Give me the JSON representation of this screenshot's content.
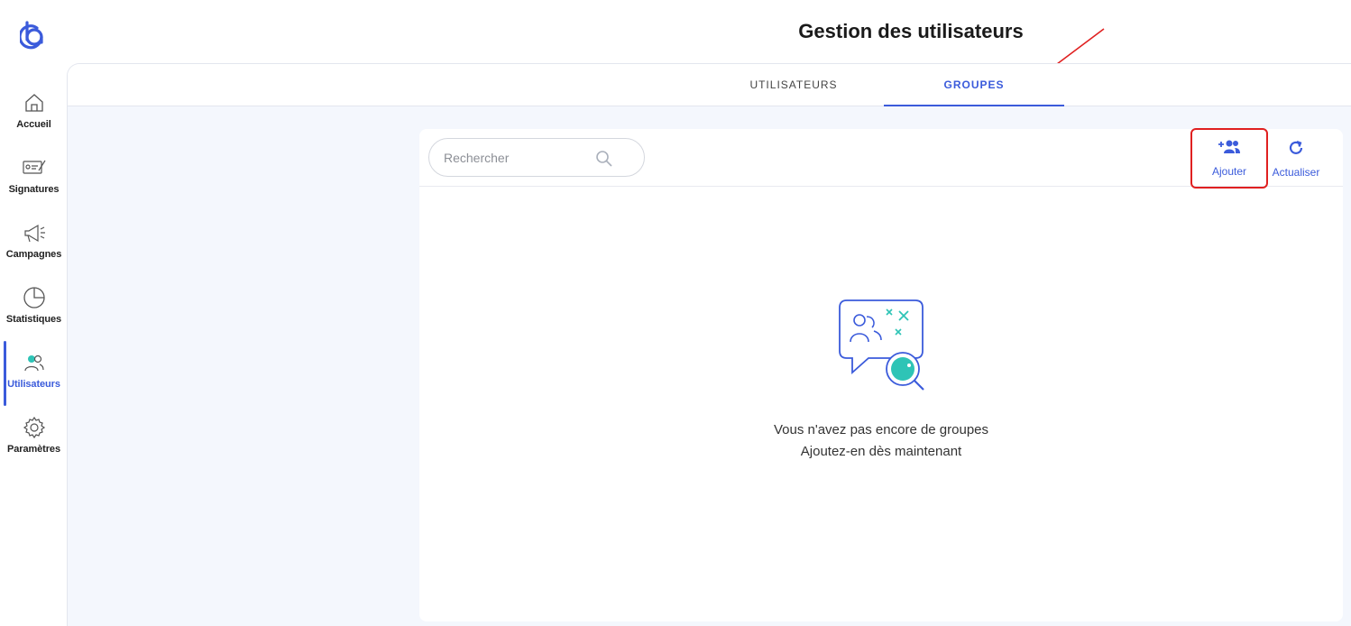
{
  "header": {
    "title": "Gestion des utilisateurs"
  },
  "sidebar": {
    "logo_icon": "brand-logo-icon",
    "items": [
      {
        "label": "Accueil",
        "icon": "home-icon"
      },
      {
        "label": "Signatures",
        "icon": "signature-icon"
      },
      {
        "label": "Campagnes",
        "icon": "megaphone-icon"
      },
      {
        "label": "Statistiques",
        "icon": "pie-chart-icon"
      },
      {
        "label": "Utilisateurs",
        "icon": "users-icon",
        "active": true
      },
      {
        "label": "Paramètres",
        "icon": "gear-icon"
      }
    ]
  },
  "tabs": [
    {
      "label": "UTILISATEURS",
      "active": false
    },
    {
      "label": "GROUPES",
      "active": true
    }
  ],
  "toolbar": {
    "search_placeholder": "Rechercher",
    "add_label": "Ajouter",
    "refresh_label": "Actualiser"
  },
  "empty_state": {
    "line1": "Vous n'avez pas encore de groupes",
    "line2": "Ajoutez-en dès maintenant"
  },
  "colors": {
    "accent": "#3b5bdb",
    "highlight_box": "#e02020",
    "illustration_teal": "#2ec4b6",
    "background": "#f4f7fd"
  }
}
